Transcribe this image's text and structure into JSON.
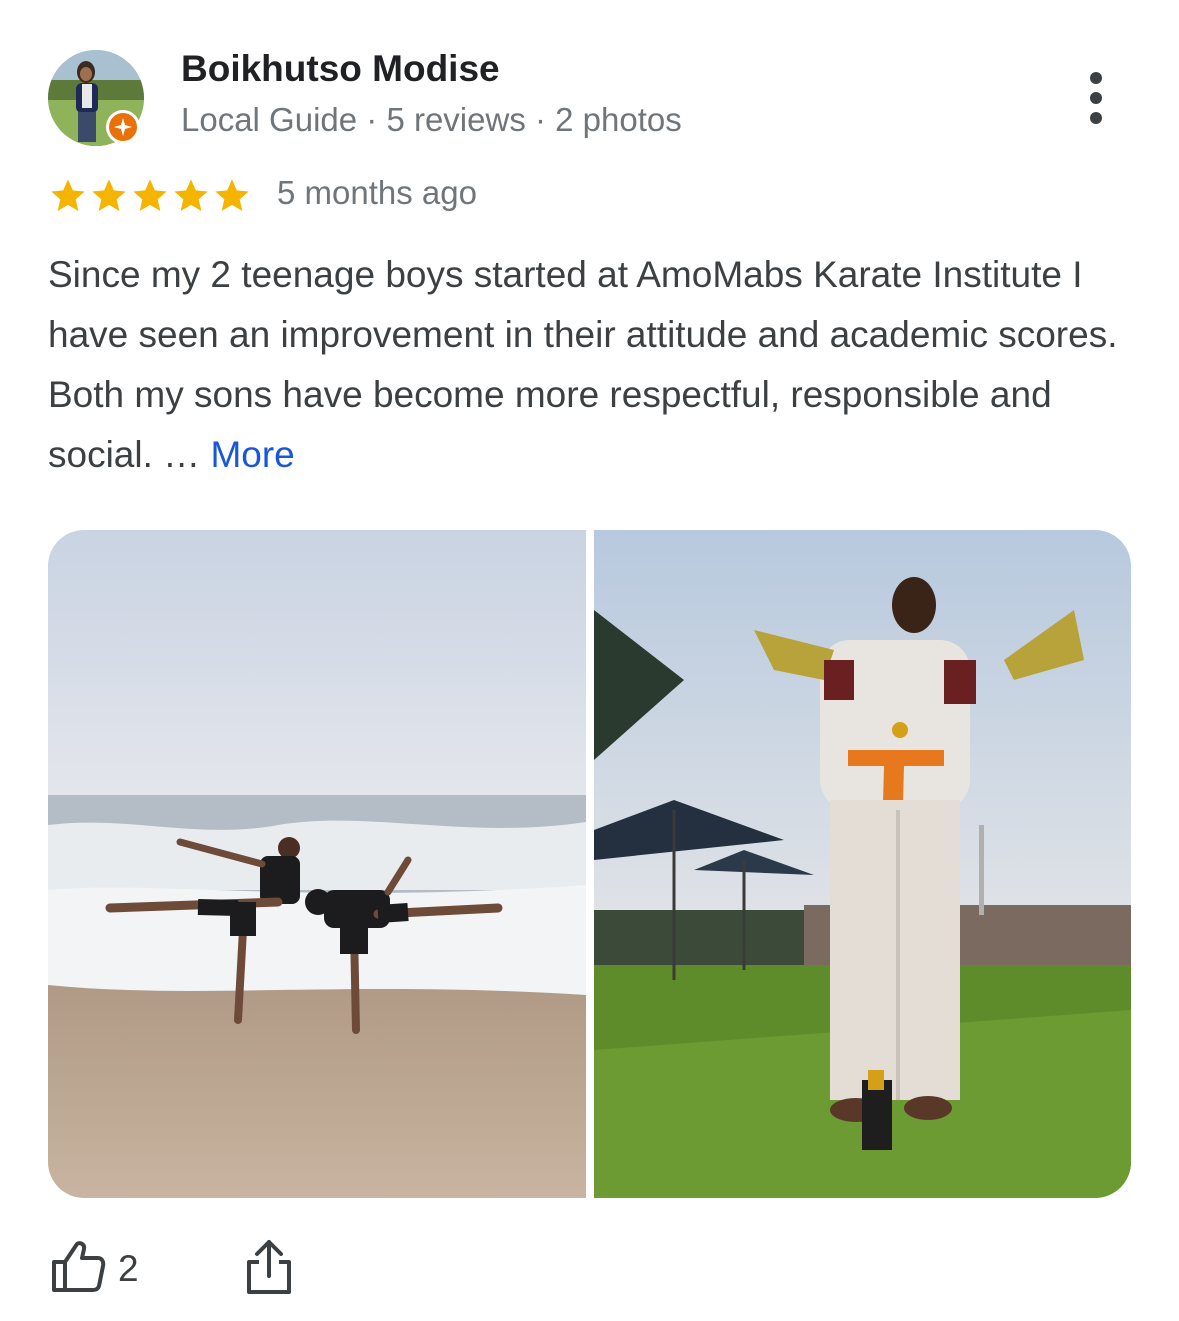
{
  "reviewer": {
    "name": "Boikhutso Modise",
    "meta": "Local Guide · 5 reviews · 2 photos",
    "avatar_icon": "profile-photo",
    "badge_icon": "local-guide-star-icon"
  },
  "rating": {
    "stars": 5,
    "max": 5,
    "time": "5 months ago",
    "color": "#f5b400"
  },
  "review": {
    "text": "Since my 2 teenage boys started at AmoMabs Karate Institute I have seen an improvement in their attitude and academic scores. Both my sons have become more respectful, responsible and social. …",
    "more_label": "More"
  },
  "photos": [
    {
      "alt": "two boys kicking on beach",
      "icon": "beach-photo"
    },
    {
      "alt": "boy in karate gi holding trophies",
      "icon": "trophy-photo"
    }
  ],
  "actions": {
    "like_count": "2",
    "like_icon": "thumbs-up-icon",
    "share_icon": "share-icon",
    "menu_icon": "more-vert-icon"
  },
  "colors": {
    "link": "#1a57d6",
    "badge": "#e8710a",
    "star": "#f5b400"
  }
}
